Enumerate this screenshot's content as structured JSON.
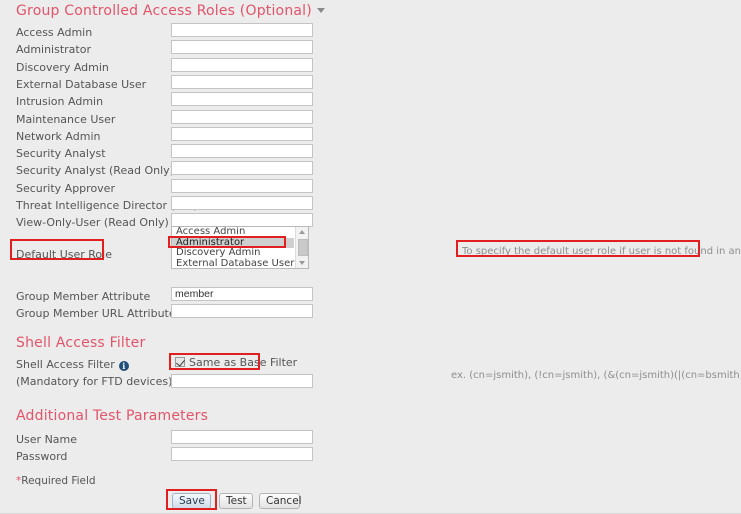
{
  "sections": {
    "group_roles": {
      "title": "Group Controlled Access Roles (Optional)",
      "fields": [
        {
          "label": "Access Admin",
          "value": ""
        },
        {
          "label": "Administrator",
          "value": ""
        },
        {
          "label": "Discovery Admin",
          "value": ""
        },
        {
          "label": "External Database User",
          "value": ""
        },
        {
          "label": "Intrusion Admin",
          "value": ""
        },
        {
          "label": "Maintenance User",
          "value": ""
        },
        {
          "label": "Network Admin",
          "value": ""
        },
        {
          "label": "Security Analyst",
          "value": ""
        },
        {
          "label": "Security Analyst (Read Only)",
          "value": ""
        },
        {
          "label": "Security Approver",
          "value": ""
        },
        {
          "label": "Threat Intelligence Director (TID) User",
          "value": ""
        },
        {
          "label": "View-Only-User (Read Only)",
          "value": ""
        }
      ],
      "default_user_role": {
        "label": "Default User Role",
        "options": [
          {
            "text": "Access Admin",
            "selected": false
          },
          {
            "text": "Administrator",
            "selected": true
          },
          {
            "text": "Discovery Admin",
            "selected": false
          },
          {
            "text": "External Database User",
            "selected": false
          }
        ],
        "note": "To specify the default user role if user is not found in any group"
      },
      "member_fields": [
        {
          "label": "Group Member Attribute",
          "value": "member"
        },
        {
          "label": "Group Member URL Attribute",
          "value": ""
        }
      ]
    },
    "shell_access": {
      "title": "Shell Access Filter",
      "field_label": "Shell Access Filter",
      "info_icon": "info-icon",
      "sub_label": "(Mandatory for FTD devices)",
      "checkbox_label": "Same as Base Filter",
      "checkbox_checked": true,
      "filter_value": "",
      "example": "ex. (cn=jsmith), (!cn=jsmith), (&(cn=jsmith)(|(cn=bsmith)(cn=csmith*)))"
    },
    "additional_test": {
      "title": "Additional Test Parameters",
      "fields": [
        {
          "label": "User Name",
          "value": ""
        },
        {
          "label": "Password",
          "value": ""
        }
      ]
    }
  },
  "required_note": {
    "star": "*",
    "text": "Required Field"
  },
  "buttons": [
    {
      "name": "save",
      "label": "Save",
      "primary": true
    },
    {
      "name": "test",
      "label": "Test",
      "primary": false
    },
    {
      "name": "cancel",
      "label": "Cancel",
      "primary": false
    }
  ],
  "colors": {
    "accent": "#e2546a",
    "highlight": "#e02020",
    "background": "#ececec",
    "info": "#1f4e79"
  }
}
